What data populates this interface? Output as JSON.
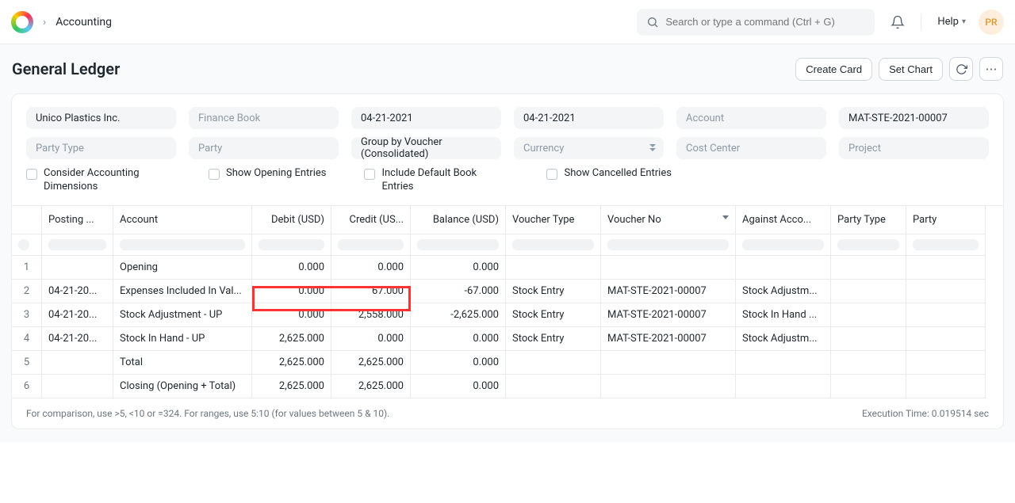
{
  "nav": {
    "breadcrumb": "Accounting",
    "search_placeholder": "Search or type a command (Ctrl + G)",
    "help_label": "Help",
    "avatar": "PR"
  },
  "header": {
    "title": "General Ledger",
    "create_card": "Create Card",
    "set_chart": "Set Chart"
  },
  "filters": {
    "company": "Unico Plastics Inc.",
    "finance_book_ph": "Finance Book",
    "from_date": "04-21-2021",
    "to_date": "04-21-2021",
    "account_ph": "Account",
    "voucher_no": "MAT-STE-2021-00007",
    "party_type_ph": "Party Type",
    "party_ph": "Party",
    "group_by": "Group by Voucher (Consolidated)",
    "currency_ph": "Currency",
    "cost_center_ph": "Cost Center",
    "project_ph": "Project"
  },
  "checkboxes": {
    "dimensions": "Consider Accounting Dimensions",
    "opening": "Show Opening Entries",
    "default_book": "Include Default Book Entries",
    "cancelled": "Show Cancelled Entries"
  },
  "columns": [
    "",
    "Posting ...",
    "Account",
    "Debit (USD)",
    "Credit (US...",
    "Balance (USD)",
    "Voucher Type",
    "Voucher No",
    "Against Acco...",
    "Party Type",
    "Party"
  ],
  "rows": [
    {
      "n": "1",
      "date": "",
      "account": "Opening",
      "debit": "0.000",
      "credit": "0.000",
      "balance": "0.000",
      "vtype": "",
      "vno": "",
      "against": "",
      "ptype": "",
      "party": ""
    },
    {
      "n": "2",
      "date": "04-21-20...",
      "account": "Expenses Included In Val...",
      "debit": "0.000",
      "credit": "67.000",
      "balance": "-67.000",
      "vtype": "Stock Entry",
      "vno": "MAT-STE-2021-00007",
      "against": "Stock Adjustm...",
      "ptype": "",
      "party": ""
    },
    {
      "n": "3",
      "date": "04-21-20...",
      "account": "Stock Adjustment - UP",
      "debit": "0.000",
      "credit": "2,558.000",
      "balance": "-2,625.000",
      "vtype": "Stock Entry",
      "vno": "MAT-STE-2021-00007",
      "against": "Stock In Hand ...",
      "ptype": "",
      "party": ""
    },
    {
      "n": "4",
      "date": "04-21-20...",
      "account": "Stock In Hand - UP",
      "debit": "2,625.000",
      "credit": "0.000",
      "balance": "0.000",
      "vtype": "Stock Entry",
      "vno": "MAT-STE-2021-00007",
      "against": "Stock Adjustm...",
      "ptype": "",
      "party": ""
    },
    {
      "n": "5",
      "date": "",
      "account": "Total",
      "debit": "2,625.000",
      "credit": "2,625.000",
      "balance": "0.000",
      "vtype": "",
      "vno": "",
      "against": "",
      "ptype": "",
      "party": ""
    },
    {
      "n": "6",
      "date": "",
      "account": "Closing (Opening + Total)",
      "debit": "2,625.000",
      "credit": "2,625.000",
      "balance": "0.000",
      "vtype": "",
      "vno": "",
      "against": "",
      "ptype": "",
      "party": ""
    }
  ],
  "footer": {
    "hint": "For comparison, use >5, <10 or =324. For ranges, use 5:10 (for values between 5 & 10).",
    "exec": "Execution Time: 0.019514 sec"
  }
}
